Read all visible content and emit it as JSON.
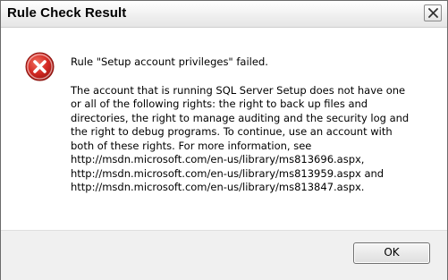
{
  "window": {
    "title": "Rule Check Result",
    "close_icon": "close-icon"
  },
  "message": {
    "icon": "error-icon",
    "heading": "Rule \"Setup account privileges\" failed.",
    "lines": [
      "The account that is running SQL Server Setup does not have one",
      "or all of the following rights: the right to back up files and",
      "directories, the right to manage auditing and the security log and",
      "the right to debug programs. To continue, use an account with",
      "both of these rights. For more information, see",
      "http://msdn.microsoft.com/en-us/library/ms813696.aspx,",
      "http://msdn.microsoft.com/en-us/library/ms813959.aspx and",
      "http://msdn.microsoft.com/en-us/library/ms813847.aspx."
    ]
  },
  "buttons": {
    "ok_label": "OK"
  },
  "colors": {
    "error_red": "#d42a24",
    "footer_bg": "#f0f0f0"
  }
}
